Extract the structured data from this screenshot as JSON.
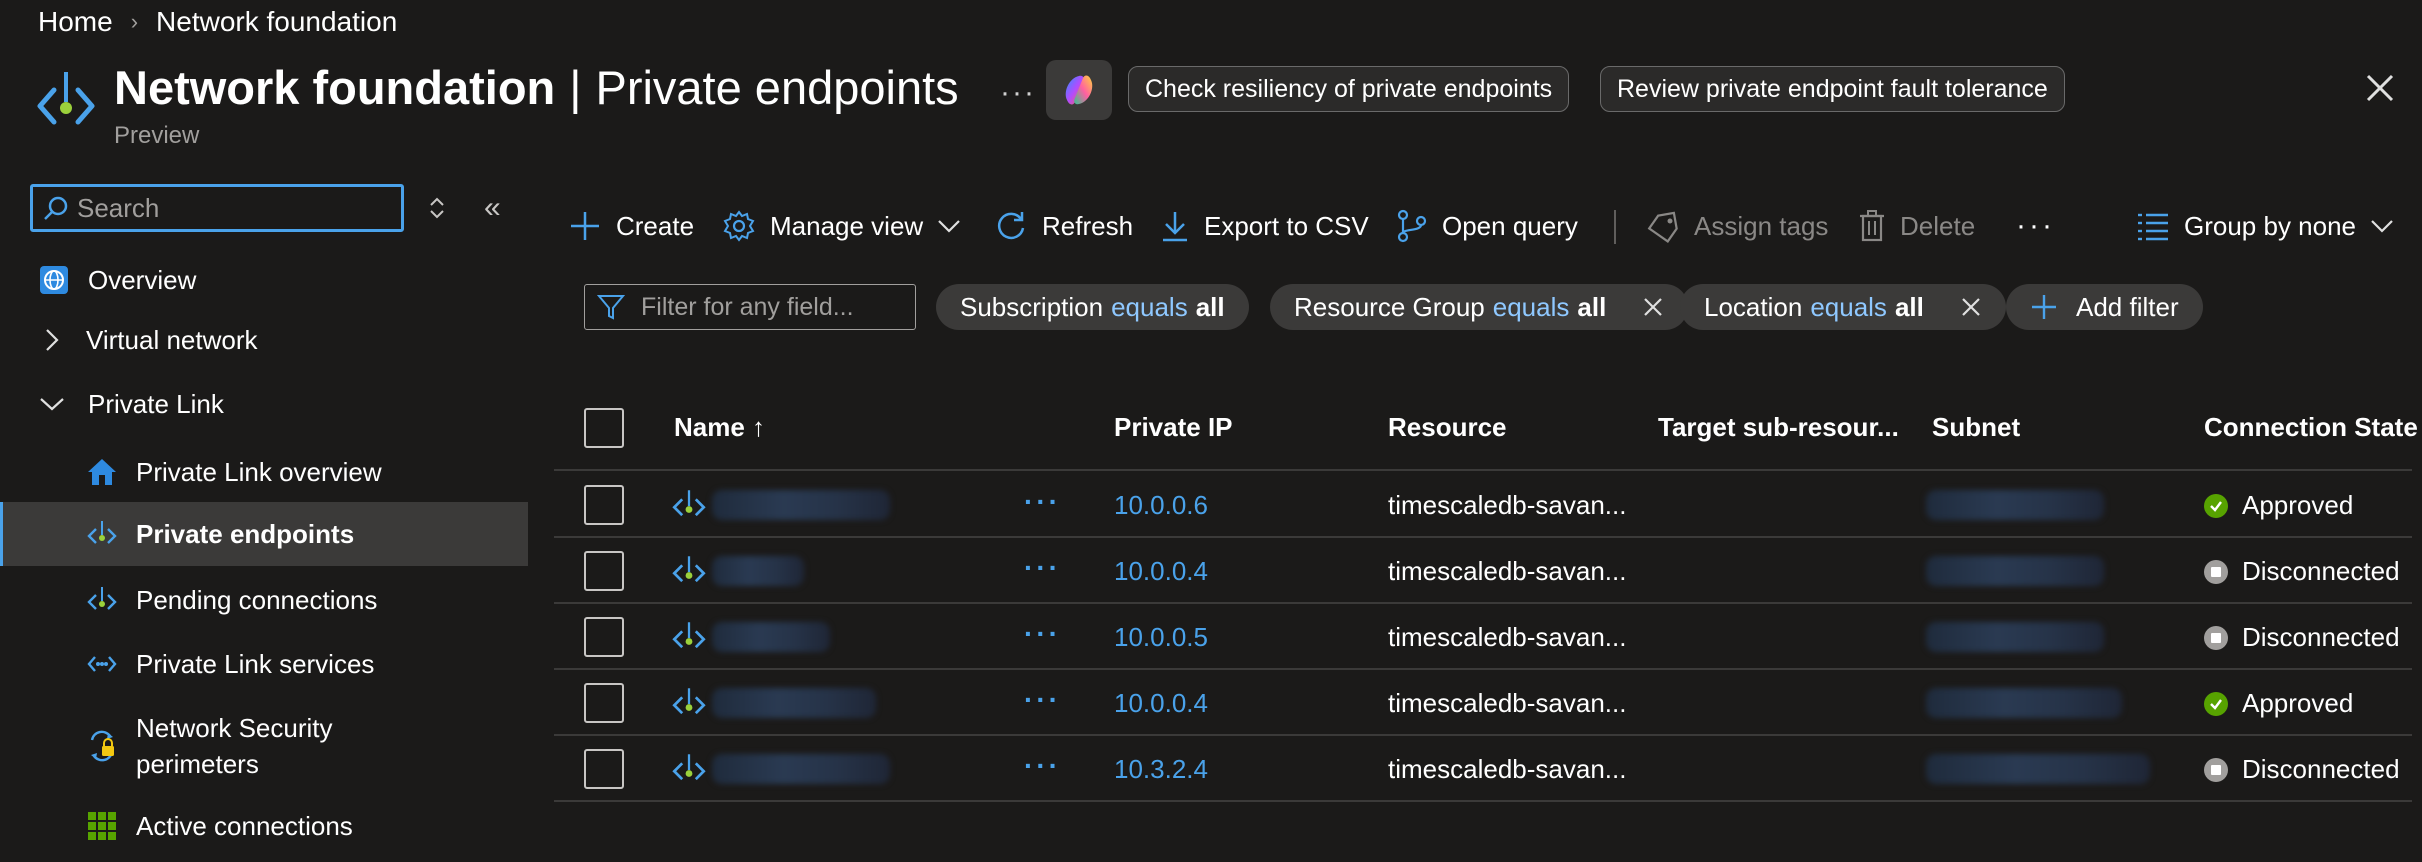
{
  "breadcrumb": {
    "home": "Home",
    "current": "Network foundation"
  },
  "header": {
    "title_bold": "Network foundation",
    "title_sep": "|",
    "title_rest": "Private endpoints",
    "subtitle": "Preview",
    "more": "···",
    "prompt_buttons": [
      "Check resiliency of private endpoints",
      "Review private endpoint fault tolerance"
    ]
  },
  "sidebar": {
    "search_placeholder": "Search",
    "items": [
      {
        "label": "Overview",
        "icon": "globe-icon"
      },
      {
        "label": "Virtual network",
        "icon": "chevron-right-icon"
      },
      {
        "label": "Private Link",
        "icon": "chevron-down-icon"
      },
      {
        "label": "Private Link overview",
        "icon": "home-icon"
      },
      {
        "label": "Private endpoints",
        "icon": "private-endpoint-icon",
        "selected": true
      },
      {
        "label": "Pending connections",
        "icon": "private-endpoint-icon"
      },
      {
        "label": "Private Link services",
        "icon": "private-link-service-icon"
      },
      {
        "label": "Network Security",
        "label2": "perimeters",
        "icon": "security-perimeter-icon"
      },
      {
        "label": "Active connections",
        "icon": "grid-icon"
      }
    ]
  },
  "toolbar": {
    "create": "Create",
    "manage_view": "Manage view",
    "refresh": "Refresh",
    "export": "Export to CSV",
    "open_query": "Open query",
    "assign_tags": "Assign tags",
    "delete": "Delete",
    "more": "···",
    "group_by": "Group by none"
  },
  "filters": {
    "placeholder": "Filter for any field...",
    "chips": [
      {
        "field": "Subscription",
        "op": "equals",
        "value": "all",
        "removable": false
      },
      {
        "field": "Resource Group",
        "op": "equals",
        "value": "all",
        "removable": true
      },
      {
        "field": "Location",
        "op": "equals",
        "value": "all",
        "removable": true
      }
    ],
    "add_filter": "Add filter"
  },
  "table": {
    "columns": [
      "Name ↑",
      "Private IP",
      "Resource",
      "Target sub-resour...",
      "Subnet",
      "Connection State"
    ],
    "rows": [
      {
        "private_ip": "10.0.0.6",
        "resource": "timescaledb-savan...",
        "state": "Approved"
      },
      {
        "private_ip": "10.0.0.4",
        "resource": "timescaledb-savan...",
        "state": "Disconnected"
      },
      {
        "private_ip": "10.0.0.5",
        "resource": "timescaledb-savan...",
        "state": "Disconnected"
      },
      {
        "private_ip": "10.0.0.4",
        "resource": "timescaledb-savan...",
        "state": "Approved"
      },
      {
        "private_ip": "10.3.2.4",
        "resource": "timescaledb-savan...",
        "state": "Disconnected"
      }
    ],
    "row_more": "···"
  },
  "colors": {
    "accent": "#4aa2ea",
    "approved": "#57a300",
    "background": "#1b1a19"
  }
}
